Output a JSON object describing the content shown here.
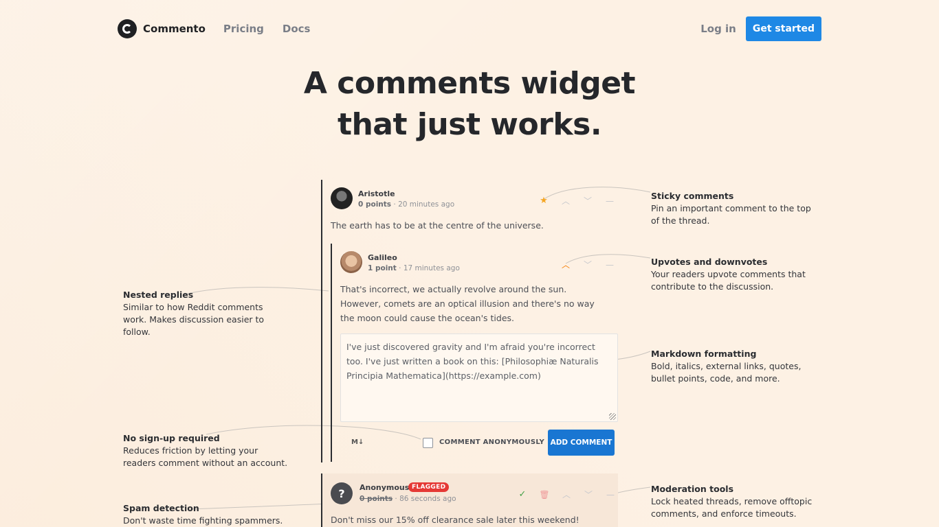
{
  "nav": {
    "brand": "Commento",
    "links": [
      "Pricing",
      "Docs"
    ],
    "login": "Log in",
    "cta": "Get started"
  },
  "hero": {
    "line1": "A comments widget",
    "line2": "that just works."
  },
  "comments": [
    {
      "name": "Aristotle",
      "points": "0 points",
      "time": "20 minutes ago",
      "body": "The earth has to be at the centre of the universe."
    },
    {
      "name": "Galileo",
      "points": "1 point",
      "time": "17 minutes ago",
      "body": "That's incorrect, we actually revolve around the sun. However, comets are an optical illusion and there's no way the moon could cause the ocean's tides."
    },
    {
      "name": "Anonymous",
      "badge": "FLAGGED",
      "points": "0 points",
      "time": "86 seconds ago",
      "body": "Don't miss our 15% off clearance sale later this weekend!"
    }
  ],
  "reply": {
    "text": "I've just discovered gravity and I'm afraid you're incorrect too. I've just written a book on this: [Philosophiæ Naturalis Principia Mathematica](https://example.com)",
    "markdown": "M↓",
    "anon_label": "COMMENT ANONYMOUSLY",
    "submit": "ADD COMMENT"
  },
  "features_right": [
    {
      "title": "Sticky comments",
      "desc": "Pin an important comment to the top of the thread."
    },
    {
      "title": "Upvotes and downvotes",
      "desc": "Your readers upvote comments that contribute to the discussion."
    },
    {
      "title": "Markdown formatting",
      "desc": "Bold, italics, external links, quotes, bullet points, code, and more."
    },
    {
      "title": "Moderation tools",
      "desc": "Lock heated threads, remove offtopic comments, and enforce timeouts."
    }
  ],
  "features_left": [
    {
      "title": "Nested replies",
      "desc": "Similar to how Reddit comments work. Makes discussion easier to follow."
    },
    {
      "title": "No sign-up required",
      "desc": "Reduces friction by letting your readers comment without an account."
    },
    {
      "title": "Spam detection",
      "desc": "Don't waste time fighting spammers."
    }
  ],
  "colors": {
    "accent": "#1e88e5",
    "star": "#f5a623",
    "upvote": "#f57c00",
    "flag": "#e53935",
    "approve": "#43a047",
    "delete": "#ef9a9a"
  },
  "icons": [
    "star-icon",
    "chevron-up-icon",
    "chevron-down-icon",
    "collapse-icon",
    "checkmark-icon",
    "trash-icon"
  ]
}
